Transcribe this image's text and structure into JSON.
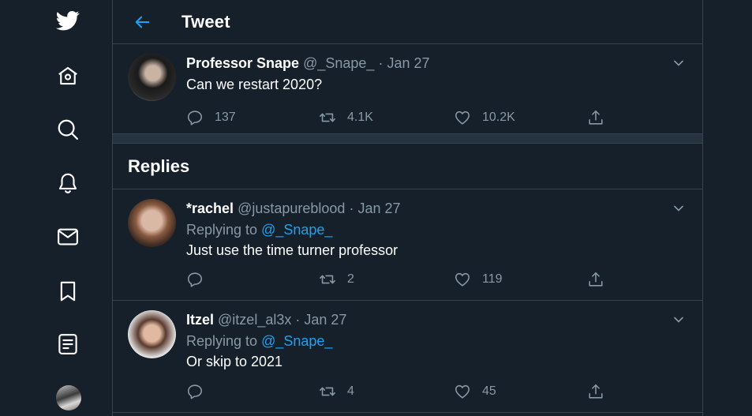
{
  "nav": {
    "icons": [
      "twitter-logo-icon",
      "home-icon",
      "explore-icon",
      "notifications-icon",
      "messages-icon",
      "bookmarks-icon",
      "lists-icon"
    ]
  },
  "header": {
    "title": "Tweet"
  },
  "main_tweet": {
    "name": "Professor Snape",
    "handle": "@_Snape_",
    "dot": "·",
    "date": "Jan 27",
    "text": "Can we restart 2020?",
    "replies": "137",
    "retweets": "4.1K",
    "likes": "10.2K"
  },
  "replies_section": {
    "title": "Replies"
  },
  "replies": [
    {
      "name": "*rachel",
      "handle": "@justapureblood",
      "dot": "·",
      "date": "Jan 27",
      "replying_prefix": "Replying to ",
      "replying_to": "@_Snape_",
      "text": "Just use the time turner professor",
      "replies": "",
      "retweets": "2",
      "likes": "119"
    },
    {
      "name": "Itzel",
      "handle": "@itzel_al3x",
      "dot": "·",
      "date": "Jan 27",
      "replying_prefix": "Replying to ",
      "replying_to": "@_Snape_",
      "text": "Or skip to 2021",
      "replies": "",
      "retweets": "4",
      "likes": "45"
    }
  ],
  "colors": {
    "background": "#15202b",
    "border": "#38444d",
    "accent": "#1da1f2",
    "secondary_text": "#8899a6"
  }
}
